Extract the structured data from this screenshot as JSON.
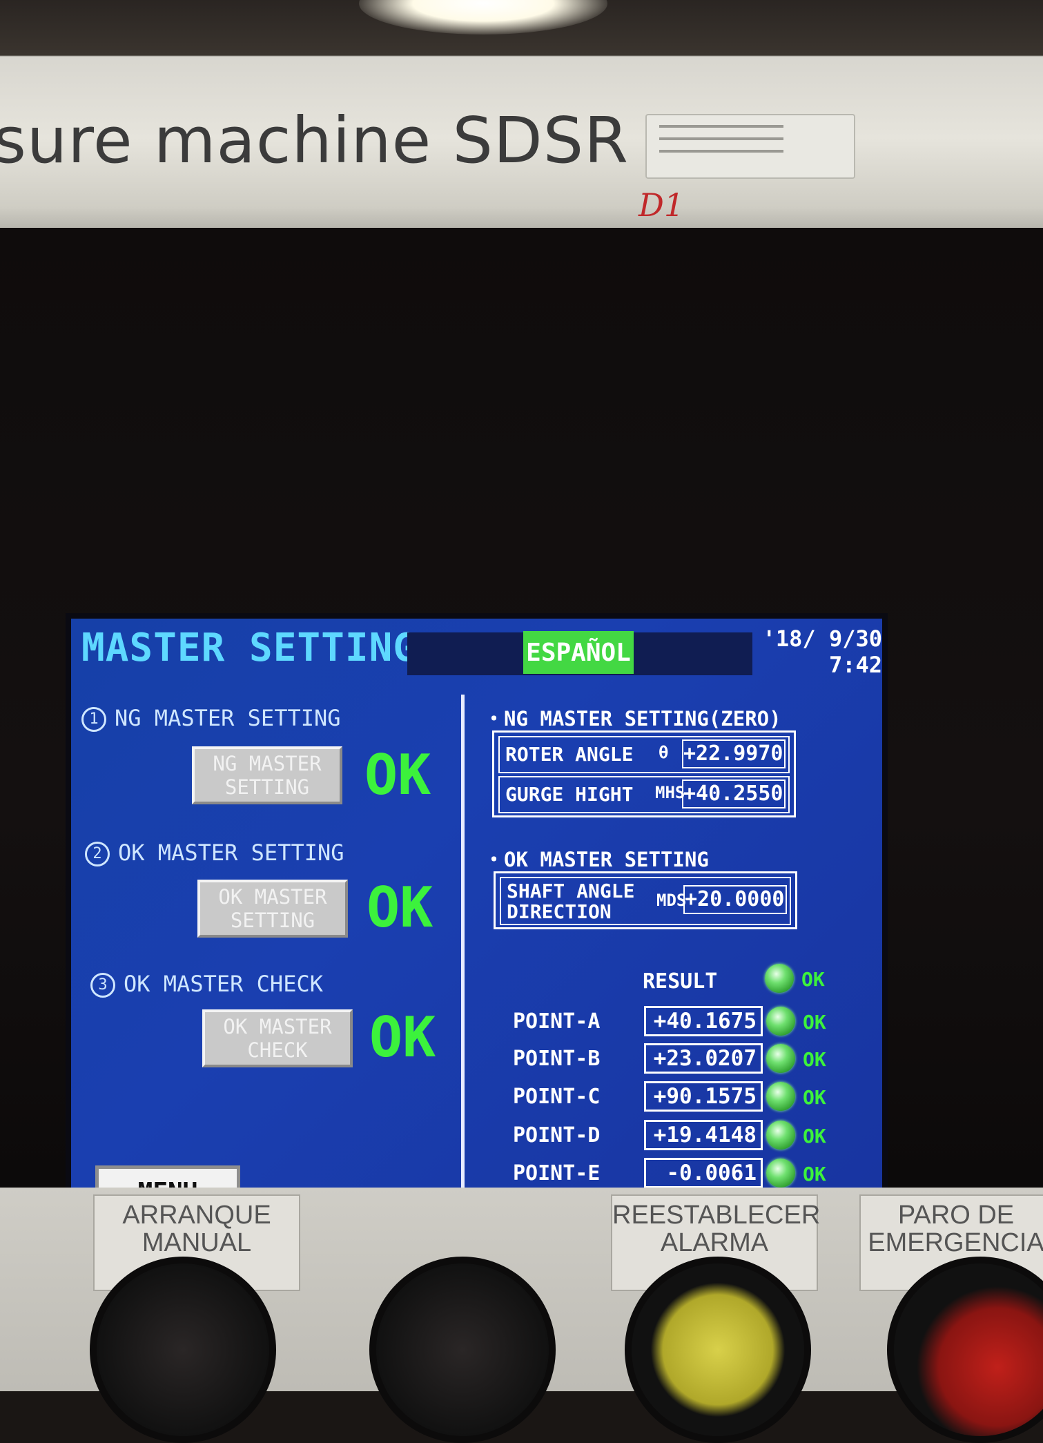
{
  "machine": {
    "label": "sure machine SDSR",
    "marker": "D1"
  },
  "screen": {
    "title": "MASTER SETTING",
    "language_button": "ESPAÑOL",
    "date": "'18/ 9/30",
    "time": "7:42",
    "steps": [
      {
        "num": "1",
        "label": "NG MASTER SETTING",
        "button": "NG MASTER SETTING",
        "status": "OK"
      },
      {
        "num": "2",
        "label": "OK MASTER SETTING",
        "button": "OK MASTER SETTING",
        "status": "OK"
      },
      {
        "num": "3",
        "label": "OK MASTER CHECK",
        "button": "OK MASTER CHECK",
        "status": "OK"
      }
    ],
    "menu_button": "MENU",
    "ng_section": {
      "title": "・NG MASTER SETTING(ZERO)",
      "rows": [
        {
          "name": "ROTER ANGLE",
          "symbol": "θ",
          "value": "+22.9970"
        },
        {
          "name": "GURGE HIGHT",
          "symbol": "MHS",
          "value": "+40.2550"
        }
      ]
    },
    "ok_section": {
      "title": "・OK MASTER SETTING",
      "rows": [
        {
          "name": "SHAFT ANGLE DIRECTION",
          "symbol": "MDS",
          "value": "+20.0000"
        }
      ]
    },
    "result": {
      "label": "RESULT",
      "status": "OK",
      "points": [
        {
          "name": "POINT-A",
          "value": "+40.1675",
          "status": "OK"
        },
        {
          "name": "POINT-B",
          "value": "+23.0207",
          "status": "OK"
        },
        {
          "name": "POINT-C",
          "value": "+90.1575",
          "status": "OK"
        },
        {
          "name": "POINT-D",
          "value": "+19.4148",
          "status": "OK"
        },
        {
          "name": "POINT-E",
          "value": "-0.0061",
          "status": "OK"
        }
      ]
    },
    "colors": {
      "title": "#5ed8ff",
      "ok": "#3cf23c",
      "background": "#1a3fb0",
      "language": "#43d843"
    }
  },
  "panel": {
    "plates": [
      "ARRANQUE MANUAL",
      "REESTABLECER ALARMA",
      "PARO DE EMERGENCIA"
    ]
  }
}
